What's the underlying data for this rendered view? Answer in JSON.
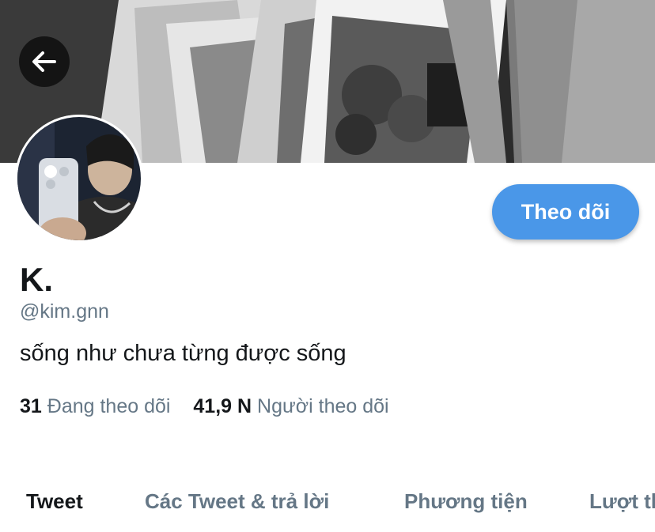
{
  "profile": {
    "display_name": "K.",
    "handle": "@kim.gnn",
    "bio": "sống như chưa từng được sống"
  },
  "actions": {
    "follow_label": "Theo dõi"
  },
  "stats": {
    "following_count": "31",
    "following_label": "Đang theo dõi",
    "followers_count": "41,9 N",
    "followers_label": "Người theo dõi"
  },
  "tabs": [
    {
      "label": "Tweet",
      "active": true
    },
    {
      "label": "Các Tweet & trả lời",
      "active": false
    },
    {
      "label": "Phương tiện",
      "active": false
    },
    {
      "label": "Lượt thích",
      "active": false
    }
  ],
  "icons": {
    "back": "arrow-left-icon"
  },
  "colors": {
    "accent": "#4a97e8",
    "text_primary": "#14171a",
    "text_secondary": "#657786"
  }
}
